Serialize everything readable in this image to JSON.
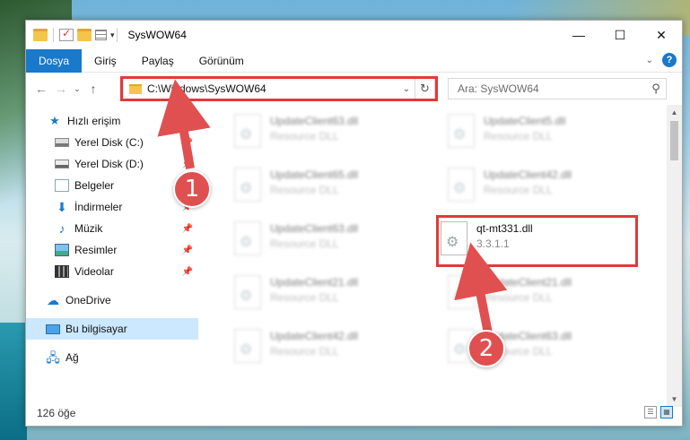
{
  "window": {
    "title": "SysWOW64"
  },
  "window_controls": {
    "minimize": "—",
    "maximize": "☐",
    "close": "✕"
  },
  "ribbon": {
    "tabs": [
      "Dosya",
      "Giriş",
      "Paylaş",
      "Görünüm"
    ],
    "active_tab": "Dosya",
    "help": "?"
  },
  "nav": {
    "back": "←",
    "forward": "→",
    "recent": "⌄",
    "up": "↑"
  },
  "address": {
    "path": "C:\\Windows\\SysWOW64",
    "dropdown": "⌄",
    "refresh": "↻"
  },
  "search": {
    "placeholder": "Ara: SysWOW64",
    "icon": "search-icon"
  },
  "sidebar": {
    "items": [
      {
        "label": "Hızlı erişim",
        "icon": "star-icon",
        "pinned": false
      },
      {
        "label": "Yerel Disk (C:)",
        "icon": "drive-icon",
        "pinned": true
      },
      {
        "label": "Yerel Disk (D:)",
        "icon": "drive-icon",
        "pinned": true
      },
      {
        "label": "Belgeler",
        "icon": "documents-icon",
        "pinned": true
      },
      {
        "label": "İndirmeler",
        "icon": "downloads-icon",
        "pinned": true
      },
      {
        "label": "Müzik",
        "icon": "music-icon",
        "pinned": true
      },
      {
        "label": "Resimler",
        "icon": "pictures-icon",
        "pinned": true
      },
      {
        "label": "Videolar",
        "icon": "videos-icon",
        "pinned": true
      },
      {
        "label": "OneDrive",
        "icon": "onedrive-icon",
        "pinned": false
      },
      {
        "label": "Bu bilgisayar",
        "icon": "computer-icon",
        "pinned": false
      },
      {
        "label": "Ağ",
        "icon": "network-icon",
        "pinned": false
      }
    ],
    "selected": "Bu bilgisayar"
  },
  "files": [
    {
      "name": "UpdateClient63.dll",
      "desc": "Resource DLL",
      "blurred": true
    },
    {
      "name": "UpdateClient5.dll",
      "desc": "Resource DLL",
      "blurred": true
    },
    {
      "name": "UpdateClient65.dll",
      "desc": "Resource DLL",
      "blurred": true
    },
    {
      "name": "UpdateClient42.dll",
      "desc": "Resource DLL",
      "blurred": true
    },
    {
      "name": "UpdateClient63.dll",
      "desc": "Resource DLL",
      "blurred": true
    },
    {
      "name": "qt-mt331.dll",
      "desc": "3.3.1.1",
      "blurred": false
    },
    {
      "name": "UpdateClient21.dll",
      "desc": "Resource DLL",
      "blurred": true
    },
    {
      "name": "UpdateClient21.dll",
      "desc": "Resource DLL",
      "blurred": true
    },
    {
      "name": "UpdateClient42.dll",
      "desc": "Resource DLL",
      "blurred": true
    },
    {
      "name": "UpdateClient63.dll",
      "desc": "Resource DLL",
      "blurred": true
    }
  ],
  "status": {
    "item_count": "126 öğe"
  },
  "annotations": {
    "callout_1": "1",
    "callout_2": "2",
    "color": "#e03a3a"
  }
}
